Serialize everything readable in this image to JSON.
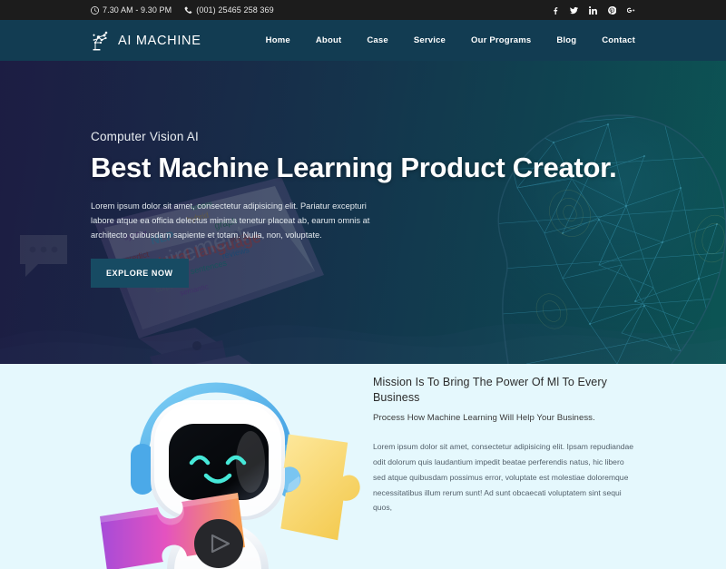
{
  "topbar": {
    "hours": "7.30 AM - 9.30 PM",
    "phone": "(001) 25465 258 369",
    "socials": [
      {
        "name": "facebook-icon",
        "label": "f"
      },
      {
        "name": "twitter-icon",
        "label": "t"
      },
      {
        "name": "linkedin-icon",
        "label": "in"
      },
      {
        "name": "pinterest-icon",
        "label": "P"
      },
      {
        "name": "googleplus-icon",
        "label": "G+"
      }
    ]
  },
  "nav": {
    "brand": "AI MACHINE",
    "logo_icon": "robot-arm-icon",
    "items": [
      {
        "label": "Home"
      },
      {
        "label": "About"
      },
      {
        "label": "Case"
      },
      {
        "label": "Service"
      },
      {
        "label": "Our Programs"
      },
      {
        "label": "Blog"
      },
      {
        "label": "Contact"
      }
    ]
  },
  "hero": {
    "subtitle": "Computer Vision AI",
    "title": "Best Machine Learning Product Creator.",
    "paragraph": "Lorem ipsum dolor sit amet, consectetur adipisicing elit. Pariatur excepturi labore atque ea officia delectus minima tenetur placeat ab, earum omnis at architecto quibusdam sapiente et totam. Nulla, non, voluptate.",
    "cta_label": "EXPLORE NOW",
    "accent_color": "#174b63",
    "bg_gradient_start": "#23244d",
    "bg_gradient_end": "#0d5a58"
  },
  "mission": {
    "heading": "Mission Is To Bring The Power Of Ml To Every Business",
    "lead": "Process How Machine Learning Will Help Your Business.",
    "paragraph": "Lorem ipsum dolor sit amet, consectetur adipisicing elit. Ipsam repudiandae odit dolorum quis laudantium impedit beatae perferendis natus, hic libero sed atque quibusdam possimus error, voluptate est molestiae doloremque necessitatibus illum rerum sunt! Ad sunt obcaecati voluptatem sint sequi quos,",
    "background_color": "#e5f8fd",
    "illustration": "robot-mascot-with-puzzle-pieces"
  }
}
